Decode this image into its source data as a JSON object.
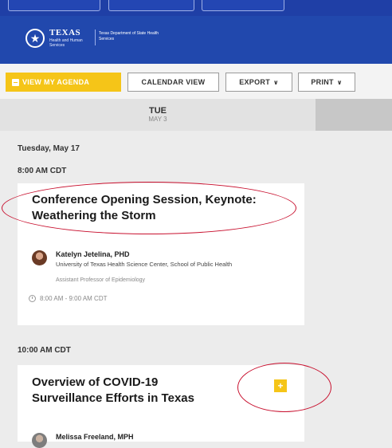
{
  "header": {
    "logo_word": "TEXAS",
    "logo_sub": "Health and Human Services",
    "logo_dept": "Texas Department of State Health Services"
  },
  "toolbar": {
    "agenda_label": "VIEW MY AGENDA",
    "calendar_label": "CALENDAR VIEW",
    "export_label": "EXPORT",
    "print_label": "PRINT"
  },
  "day_tab": {
    "name": "TUE",
    "date": "MAY 3"
  },
  "schedule": {
    "day_heading": "Tuesday, May 17",
    "slots": [
      {
        "time": "8:00 AM CDT",
        "session": {
          "title": "Conference Opening Session, Keynote: Weathering the Storm",
          "speaker_name": "Katelyn Jetelina, PHD",
          "speaker_org": "University of Texas Health Science Center, School of Public Health",
          "speaker_role": "Assistant Professor of Epidemiology",
          "time_range": "8:00 AM - 9:00 AM CDT"
        }
      },
      {
        "time": "10:00 AM CDT",
        "session": {
          "title": "Overview of COVID-19 Surveillance Efforts in Texas",
          "speaker_name": "Melissa Freeland, MPH",
          "add_label": "+"
        }
      }
    ]
  },
  "colors": {
    "brand_blue": "#2148ad",
    "accent_yellow": "#f5c518",
    "annotation_red": "#c8102e"
  }
}
